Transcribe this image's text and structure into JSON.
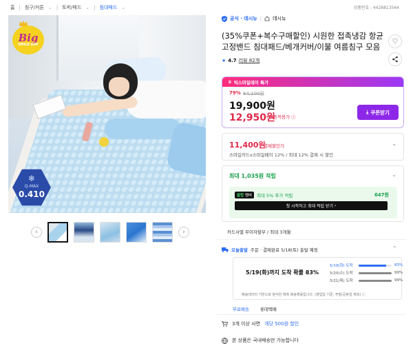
{
  "breadcrumb": [
    "홈",
    "침구/커튼",
    "토퍼/패드",
    "침대패드"
  ],
  "product_no": "상품번호 : 4428813564",
  "badges": {
    "big_top": "Big",
    "big_sub": "SMILE DAY",
    "qmax_label": "Q-MAX",
    "qmax_value": "0.410"
  },
  "store": {
    "official": "공식 · 데시뉴",
    "name": "데시뉴"
  },
  "title": "(35%쿠폰+복수구매할인) 시원한 접촉냉감 항균 고정밴드 침대패드/베개커버/이불 여름침구 모음",
  "rating": {
    "score": "4.7",
    "reviews": "리뷰 82개"
  },
  "deal": {
    "banner": "빅스마일데이 특가",
    "discount": "79%",
    "original": "64,100원",
    "price": "19,900원",
    "coupon_price": "12,950원",
    "coupon_note": "쿠폰적용가",
    "coupon_button": "쿠폰받기"
  },
  "card": {
    "price": "11,400원",
    "note": "결제할인가",
    "desc": "스마일카드x스마일페이 12% / 최대 12% 결제 시 할인"
  },
  "reward": {
    "title": "최대 1,035원 적립",
    "club_label_a": "클럽",
    "club_label_b": "멤버",
    "club_text": "최대 5% 추가 적립",
    "club_amount": "647원",
    "start_button": "첫 시작하고 최대 적립 받기"
  },
  "card_info": "카드사별 무이자할부 / 최대 3개월",
  "delivery": {
    "mark": "오늘출발",
    "text": "주문 · 결제완료 5/18(토) 출발 예정"
  },
  "arrival": {
    "headline": "5/19(화)까지 도착 확률 83%",
    "rows": [
      {
        "date": "5/19(화) 도착",
        "pct": "83%",
        "value": 83
      },
      {
        "date": "5/20(수) 도착",
        "pct": "99%",
        "value": 99
      },
      {
        "date": "5/21(목) 도착",
        "pct": "99%",
        "value": 99
      }
    ],
    "note": "배송데이터 기반으로 분석한 예측 배송확률입니다. (영업일 기준, 주말/공휴일 제외)"
  },
  "tabs": [
    "무료배송",
    "롯데택배"
  ],
  "bulk": {
    "prefix": "3개 이상 사면",
    "highlight": "개당 500원 할인"
  },
  "notice": "본 상품은 국내배송만 가능합니다"
}
